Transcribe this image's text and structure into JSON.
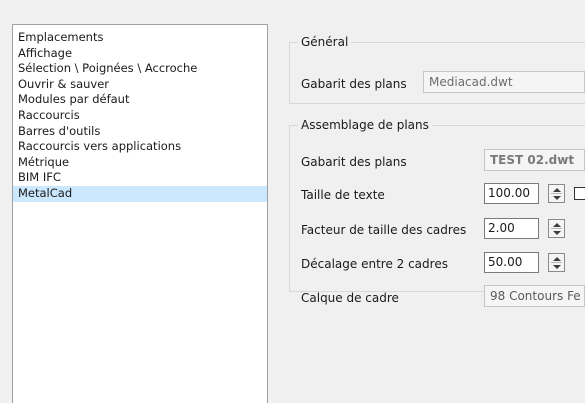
{
  "sidebar": {
    "items": [
      {
        "label": "Emplacements"
      },
      {
        "label": "Affichage"
      },
      {
        "label": "Sélection \\ Poignées \\ Accroche"
      },
      {
        "label": "Ouvrir & sauver"
      },
      {
        "label": "Modules par défaut"
      },
      {
        "label": "Raccourcis"
      },
      {
        "label": "Barres d'outils"
      },
      {
        "label": "Raccourcis vers applications"
      },
      {
        "label": "Métrique"
      },
      {
        "label": "BIM IFC"
      },
      {
        "label": "MetalCad"
      }
    ],
    "selected_index": 10
  },
  "general": {
    "title": "Général",
    "template_label": "Gabarit des plans",
    "template_value": "Mediacad.dwt"
  },
  "assembly": {
    "title": "Assemblage de plans",
    "template_label": "Gabarit des plans",
    "template_value": "TEST 02.dwt",
    "text_size_label": "Taille de texte",
    "text_size_value": "100.00",
    "frame_factor_label": "Facteur de taille des cadres",
    "frame_factor_value": "2.00",
    "offset_label": "Décalage entre 2 cadres",
    "offset_value": "50.00",
    "layer_label": "Calque de cadre",
    "layer_value": "98 Contours Fe"
  }
}
